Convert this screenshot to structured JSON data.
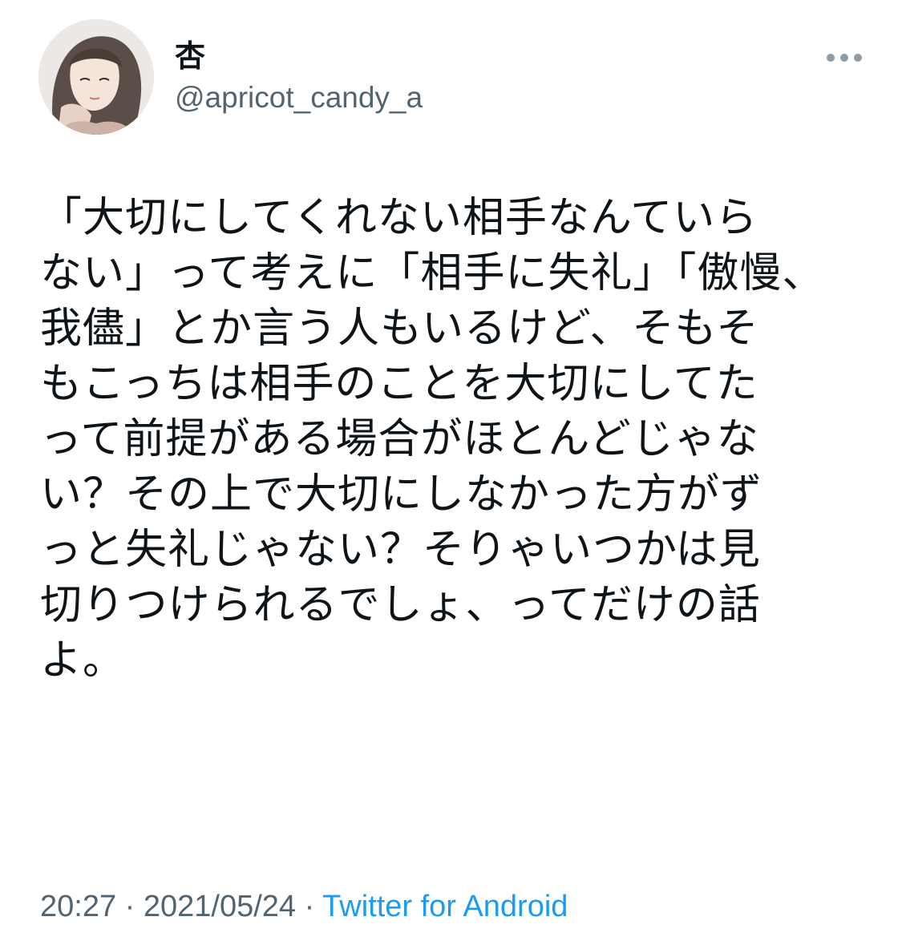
{
  "user": {
    "display_name": "杏",
    "handle": "@apricot_candy_a",
    "avatar_icon": "profile-avatar-illustration"
  },
  "more_icon": "ellipsis-icon",
  "tweet": {
    "lines": [
      "「大切にしてくれない相手なんていら",
      "ない」って考えに「相手に失礼」「傲慢、",
      "我儘」とか言う人もいるけど、そもそ",
      "もこっちは相手のことを大切にしてた",
      "って前提がある場合がほとんどじゃな",
      "い？その上で大切にしなかった方がず",
      "っと失礼じゃない？そりゃいつかは見",
      "切りつけられるでしょ、ってだけの話",
      "よ。"
    ]
  },
  "meta": {
    "time": "20:27",
    "separator": "·",
    "date": "2021/05/24",
    "source": "Twitter for Android"
  },
  "colors": {
    "text": "#0f1419",
    "secondary": "#536471",
    "link": "#1d9bf0"
  }
}
